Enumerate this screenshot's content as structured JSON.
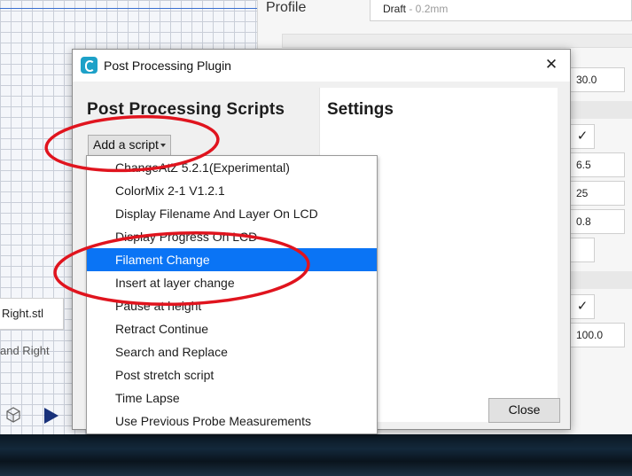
{
  "background": {
    "profile_label": "Profile",
    "profile_value": "Draft",
    "profile_sub": " - 0.2mm",
    "field_values": [
      "30.0",
      "6.5",
      "25",
      "0.8",
      "",
      "100.0"
    ],
    "object_list_item": "Right.stl",
    "object_text": "and Right",
    "check_mark": "✓"
  },
  "dialog": {
    "title": "Post Processing Plugin",
    "close_icon": "✕",
    "scripts_heading": "Post Processing Scripts",
    "add_script_label": "Add a script",
    "settings_heading": "Settings",
    "close_button_label": "Close"
  },
  "dropdown": {
    "selected": "Filament Change",
    "items": [
      "ChangeAtZ 5.2.1(Experimental)",
      "ColorMix 2-1 V1.2.1",
      "Display Filename And Layer On LCD",
      "Display Progress On LCD",
      "Filament Change",
      "Insert at layer change",
      "Pause at height",
      "Retract Continue",
      "Search and Replace",
      "Post stretch script",
      "Time Lapse",
      "Use Previous Probe Measurements"
    ]
  },
  "colors": {
    "selection": "#0a74f5",
    "annotation": "#e0141e",
    "app_icon": "#1da1c8"
  }
}
